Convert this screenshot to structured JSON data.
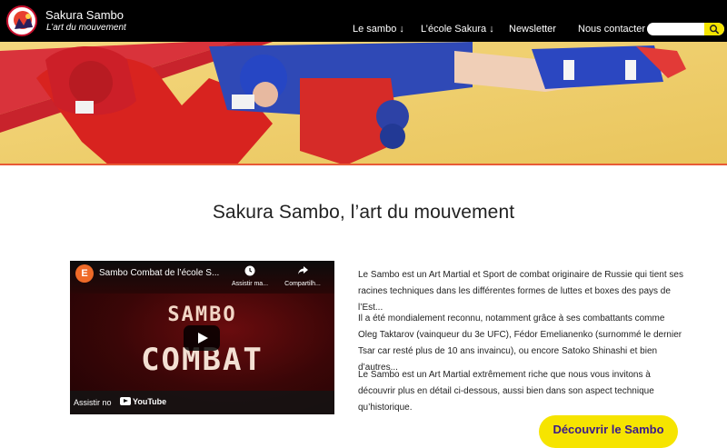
{
  "brand": {
    "title": "Sakura Sambo",
    "subtitle": "L’art du mouvement"
  },
  "nav": {
    "items": [
      {
        "label": "Le sambo ↓"
      },
      {
        "label": "L’école Sakura ↓"
      },
      {
        "label": "Newsletter"
      },
      {
        "label": "Nous contacter"
      }
    ],
    "search_placeholder": ""
  },
  "colors": {
    "navbar": "#000000",
    "accent_yellow": "#f6e400",
    "hero_line": "#e85a35",
    "cta_text": "#3a1a8a"
  },
  "main": {
    "title": "Sakura Sambo, l’art du mouvement"
  },
  "video": {
    "channel_initial": "E",
    "title": "Sambo Combat de l’école S...",
    "watch_later_label": "Assistir ma...",
    "share_label": "Compartilh...",
    "overlay_line1": "SAMBO",
    "overlay_line2": "COMBAT",
    "watch_on_label": "Assistir no",
    "youtube_label": "YouTube",
    "icons": [
      "clock-icon",
      "share-icon",
      "play-icon",
      "youtube-icon"
    ]
  },
  "paragraphs": [
    "Le Sambo est un Art Martial et Sport de combat originaire de Russie qui tient ses racines techniques dans les différentes formes de luttes et boxes des pays de l’Est...",
    "Il a été mondialement reconnu, notamment grâce à ses combattants comme Oleg Taktarov (vainqueur du 3e UFC), Fédor Emelianenko (surnommé le dernier Tsar car resté plus de 10 ans invaincu), ou encore Satoko Shinashi et bien d’autres...",
    "Le Sambo est un Art Martial extrêmement riche que nous vous invitons à découvrir plus en détail ci-dessous, aussi bien dans son aspect technique qu’historique."
  ],
  "cta": {
    "label": "Découvrir le Sambo"
  }
}
